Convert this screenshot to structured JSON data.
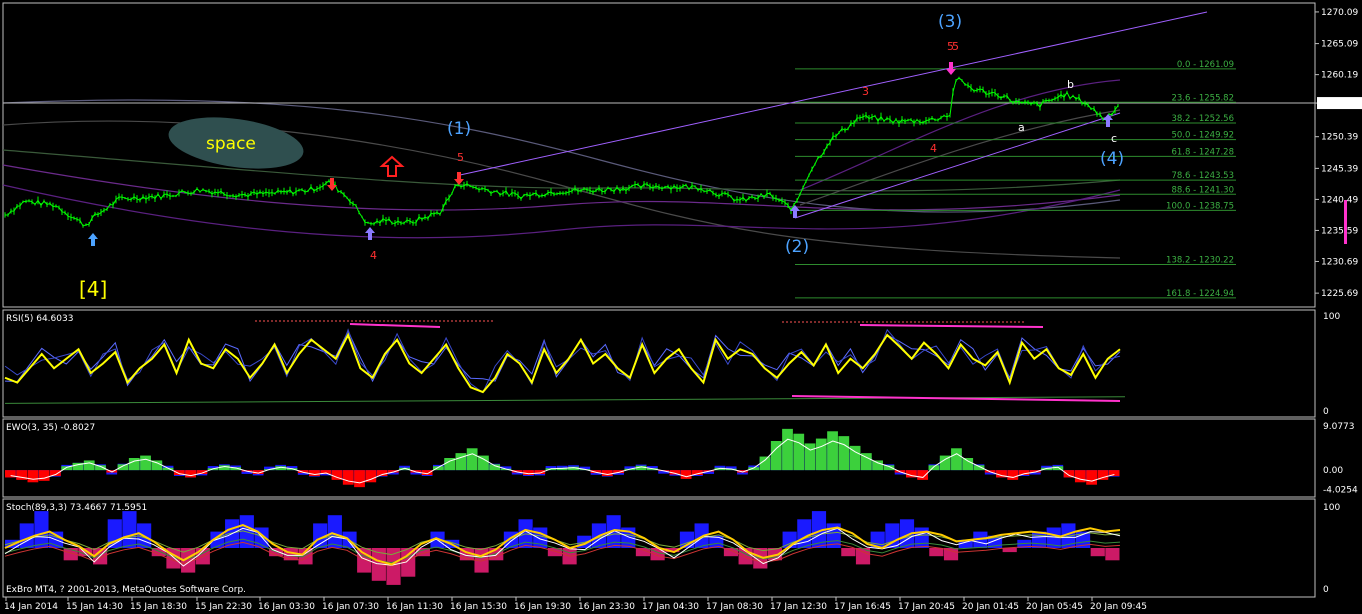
{
  "colors": {
    "background": "#000000",
    "grid_border": "#c0c0c0",
    "price": "#00ff00",
    "price_line": "#bdbdbd",
    "wave_blue": "#4da3ff",
    "wave_red": "#ff3030",
    "wave_yellow": "#ffff00",
    "fib": "#2e8b2e",
    "trend": "#a060ff",
    "rsi": "#ffff00",
    "magenta": "#ff33cc",
    "ewo_green": "#3cd03c",
    "ewo_blue": "#1a1aff",
    "ewo_red": "#ff0000",
    "stoch_blue": "#1a1aff",
    "stoch_pink": "#cc1a66"
  },
  "footer": {
    "copyright": "ExBro MT4, ? 2001-2013, MetaQuotes Software Corp."
  },
  "annotations": {
    "space_label": "space",
    "up_arrow_icon": "hollow-up-arrow",
    "wave_labels": [
      {
        "text": "[4]",
        "color": "yellow"
      },
      {
        "text": "(1)",
        "color": "blue"
      },
      {
        "text": "(2)",
        "color": "blue"
      },
      {
        "text": "(3)",
        "color": "blue"
      },
      {
        "text": "(4)",
        "color": "blue"
      },
      {
        "text": "5",
        "color": "red"
      },
      {
        "text": "4",
        "color": "red"
      },
      {
        "text": "5",
        "color": "red"
      },
      {
        "text": "3",
        "color": "red"
      },
      {
        "text": "4",
        "color": "red"
      },
      {
        "text": "5",
        "color": "red"
      },
      {
        "text": "a",
        "color": "white"
      },
      {
        "text": "b",
        "color": "white"
      },
      {
        "text": "c",
        "color": "white"
      }
    ]
  },
  "chart_data": [
    {
      "type": "line",
      "panel": "price",
      "current_price": "1255.70",
      "y_ticks": [
        "1270.09",
        "1265.09",
        "1260.19",
        "1255.70",
        "1250.39",
        "1245.39",
        "1240.49",
        "1235.59",
        "1230.69",
        "1225.69"
      ],
      "ylim": [
        1223.5,
        1271.5
      ],
      "x_ticks": [
        "14 Jan 2014",
        "15 Jan 14:30",
        "15 Jan 18:30",
        "15 Jan 22:30",
        "16 Jan 03:30",
        "16 Jan 07:30",
        "16 Jan 11:30",
        "16 Jan 15:30",
        "16 Jan 19:30",
        "16 Jan 23:30",
        "17 Jan 04:30",
        "17 Jan 08:30",
        "17 Jan 12:30",
        "17 Jan 16:45",
        "17 Jan 20:45",
        "20 Jan 01:45",
        "20 Jan 05:45",
        "20 Jan 09:45"
      ],
      "fib_levels": [
        {
          "label": "0.0 - 1261.09",
          "value": 1261.09
        },
        {
          "label": "23.6 - 1255.82",
          "value": 1255.82
        },
        {
          "label": "38.2 - 1252.56",
          "value": 1252.56
        },
        {
          "label": "50.0 - 1249.92",
          "value": 1249.92
        },
        {
          "label": "61.8 - 1247.28",
          "value": 1247.28
        },
        {
          "label": "78.6 - 1243.53",
          "value": 1243.53
        },
        {
          "label": "88.6 - 1241.30",
          "value": 1241.3
        },
        {
          "label": "100.0 - 1238.75",
          "value": 1238.75
        },
        {
          "label": "138.2 - 1230.22",
          "value": 1230.22
        },
        {
          "label": "161.8 - 1224.94",
          "value": 1224.94
        }
      ],
      "close_keypoints": [
        [
          0,
          1237.5
        ],
        [
          25,
          1240.2
        ],
        [
          55,
          1239.6
        ],
        [
          85,
          1236.4
        ],
        [
          95,
          1237.8
        ],
        [
          120,
          1240.6
        ],
        [
          160,
          1241.0
        ],
        [
          200,
          1242.0
        ],
        [
          240,
          1241.2
        ],
        [
          280,
          1241.5
        ],
        [
          310,
          1242.0
        ],
        [
          330,
          1243.2
        ],
        [
          350,
          1240.5
        ],
        [
          368,
          1236.5
        ],
        [
          385,
          1237.2
        ],
        [
          410,
          1236.8
        ],
        [
          440,
          1238.5
        ],
        [
          458,
          1243.0
        ],
        [
          480,
          1242.2
        ],
        [
          520,
          1241.0
        ],
        [
          560,
          1241.8
        ],
        [
          600,
          1242.0
        ],
        [
          650,
          1242.6
        ],
        [
          700,
          1242.4
        ],
        [
          740,
          1240.3
        ],
        [
          770,
          1241.2
        ],
        [
          793,
          1238.9
        ],
        [
          810,
          1245.0
        ],
        [
          830,
          1249.8
        ],
        [
          860,
          1253.5
        ],
        [
          900,
          1252.8
        ],
        [
          930,
          1253.0
        ],
        [
          950,
          1253.9
        ],
        [
          955,
          1259.6
        ],
        [
          975,
          1257.8
        ],
        [
          1000,
          1257.0
        ],
        [
          1020,
          1255.6
        ],
        [
          1040,
          1255.4
        ],
        [
          1065,
          1257.1
        ],
        [
          1085,
          1255.8
        ],
        [
          1105,
          1253.1
        ],
        [
          1120,
          1255.7
        ]
      ]
    },
    {
      "type": "line",
      "panel": "rsi",
      "title": "RSI(5) 64.6033",
      "y_ticks": [
        "100",
        "0"
      ],
      "ylim": [
        0,
        100
      ],
      "values": [
        35,
        30,
        45,
        60,
        45,
        55,
        65,
        40,
        50,
        62,
        30,
        45,
        55,
        70,
        40,
        75,
        50,
        45,
        65,
        55,
        35,
        50,
        70,
        40,
        60,
        75,
        65,
        55,
        80,
        45,
        35,
        60,
        75,
        50,
        40,
        55,
        70,
        45,
        25,
        20,
        35,
        60,
        50,
        30,
        65,
        40,
        55,
        75,
        50,
        60,
        45,
        35,
        70,
        40,
        55,
        65,
        45,
        30,
        75,
        55,
        65,
        60,
        45,
        35,
        50,
        62,
        48,
        70,
        40,
        55,
        45,
        60,
        80,
        68,
        55,
        72,
        60,
        45,
        70,
        55,
        48,
        62,
        30,
        72,
        55,
        65,
        45,
        38,
        60,
        35,
        55,
        65
      ]
    },
    {
      "type": "bar",
      "panel": "ewo",
      "title": "EWO(3, 35) -0.8027",
      "y_ticks": [
        "9.0773",
        "0.00",
        "-4.0254"
      ],
      "ylim": [
        -4.5,
        9.5
      ],
      "values": [
        -1.5,
        -2.0,
        -2.5,
        -2.2,
        -1.2,
        0.8,
        1.5,
        2.0,
        1.0,
        -0.5,
        1.2,
        2.5,
        3.0,
        2.0,
        0.5,
        -1.0,
        -1.5,
        -0.8,
        0.4,
        1.0,
        0.6,
        -0.3,
        -0.8,
        0.2,
        0.8,
        0.4,
        -0.6,
        -1.2,
        -0.8,
        -2.0,
        -3.0,
        -3.5,
        -2.5,
        -1.2,
        -0.5,
        0.5,
        -0.5,
        -1.0,
        0.8,
        2.5,
        3.5,
        4.5,
        3.0,
        1.2,
        0.3,
        -0.5,
        -1.0,
        -0.8,
        0.4,
        0.5,
        0.7,
        0.2,
        -0.6,
        -1.2,
        -0.6,
        0.3,
        0.9,
        0.4,
        -0.2,
        -0.9,
        -1.8,
        -1.0,
        -0.3,
        0.5,
        0.3,
        -0.5,
        0.6,
        2.8,
        6.0,
        8.5,
        7.5,
        5.5,
        6.5,
        8.0,
        7.0,
        5.0,
        3.5,
        2.0,
        1.0,
        -0.5,
        -1.5,
        -2.0,
        1.0,
        3.0,
        4.5,
        2.5,
        1.0,
        -0.5,
        -1.5,
        -2.0,
        -1.0,
        -0.5,
        0.5,
        0.8,
        -1.5,
        -2.5,
        -3.0,
        -2.0,
        -1.2
      ]
    },
    {
      "type": "bar",
      "panel": "stoch",
      "title": "Stoch(89,3,3) 73.4667 71.5951",
      "y_ticks": [
        "100",
        "0"
      ],
      "ylim": [
        0,
        100
      ],
      "histogram": [
        10,
        30,
        45,
        20,
        -15,
        -10,
        -20,
        35,
        45,
        30,
        -10,
        -25,
        -30,
        -20,
        20,
        35,
        40,
        25,
        -10,
        -15,
        -20,
        30,
        40,
        20,
        -30,
        -40,
        -45,
        -35,
        -10,
        20,
        10,
        -15,
        -30,
        -15,
        20,
        35,
        25,
        -10,
        -20,
        15,
        30,
        40,
        25,
        -10,
        -15,
        -5,
        20,
        30,
        15,
        -10,
        -20,
        -25,
        -15,
        20,
        35,
        45,
        30,
        -10,
        -20,
        20,
        30,
        35,
        25,
        -10,
        -15,
        10,
        20,
        15,
        -5,
        10,
        20,
        25,
        30,
        20,
        -10,
        -15
      ],
      "main_line": [
        50,
        58,
        65,
        70,
        60,
        52,
        40,
        55,
        63,
        68,
        58,
        45,
        35,
        45,
        60,
        72,
        78,
        70,
        55,
        45,
        42,
        60,
        68,
        62,
        45,
        35,
        30,
        40,
        55,
        62,
        55,
        45,
        40,
        48,
        62,
        72,
        68,
        60,
        50,
        55,
        65,
        72,
        70,
        62,
        50,
        45,
        55,
        65,
        70,
        60,
        45,
        38,
        42,
        55,
        65,
        72,
        75,
        68,
        55,
        50,
        60,
        68,
        70,
        66,
        58,
        60,
        62,
        66,
        68,
        70,
        68,
        64,
        70,
        74,
        70,
        72
      ]
    }
  ]
}
